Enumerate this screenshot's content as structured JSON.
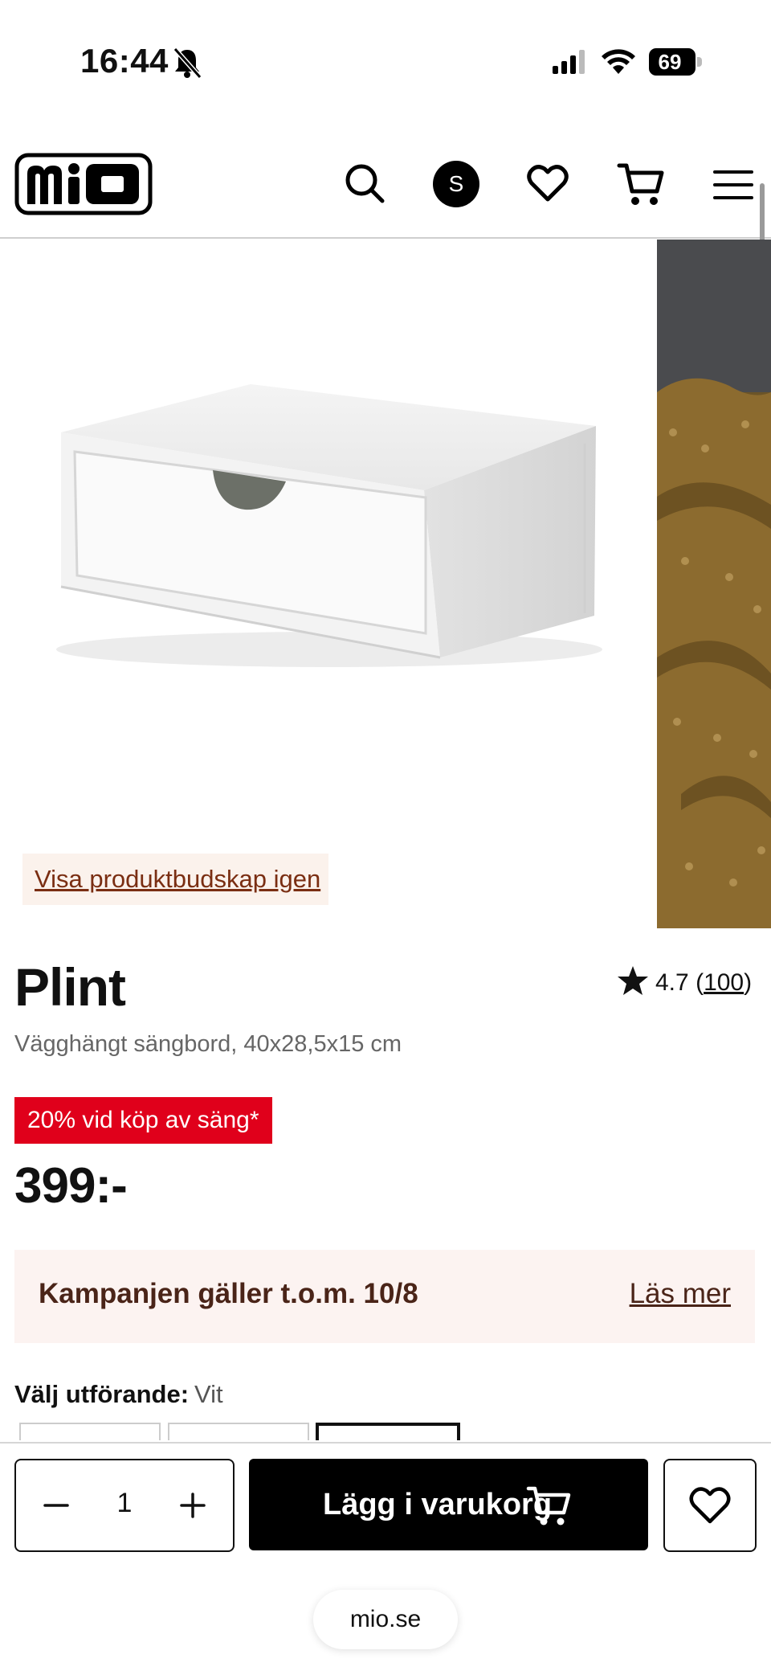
{
  "status_bar": {
    "time": "16:44",
    "battery": "69",
    "icons": [
      "bell-slash-icon",
      "signal-icon",
      "wifi-icon",
      "battery-icon"
    ]
  },
  "header": {
    "logo": "mio",
    "avatar_initial": "S",
    "icons": [
      "search-icon",
      "heart-icon",
      "cart-icon",
      "menu-icon"
    ]
  },
  "gallery": {
    "show_message_label": "Visa produktbudskap igen"
  },
  "product": {
    "title": "Plint",
    "rating_value": "4.7",
    "rating_open": "(",
    "rating_count": "100",
    "rating_close": ")",
    "subtitle": "Vägghängt sängbord, 40x28,5x15 cm",
    "promo_badge": "20% vid köp av säng*",
    "price": "399:-"
  },
  "campaign": {
    "text": "Kampanjen gäller t.o.m. 10/8",
    "link": "Läs mer"
  },
  "variant": {
    "label": "Välj utförande:",
    "value": "Vit"
  },
  "purchase_bar": {
    "quantity": "1",
    "add_to_cart_label": "Lägg i varukorg"
  },
  "browser": {
    "url": "mio.se"
  },
  "colors": {
    "promo_red": "#e0001b",
    "campaign_bg": "#fcf3f1",
    "button_black": "#000000"
  }
}
